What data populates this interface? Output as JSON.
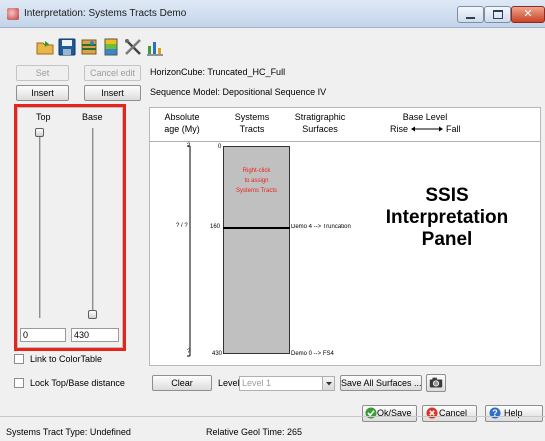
{
  "window": {
    "title": "Interpretation: Systems Tracts Demo"
  },
  "toolbar": {
    "icons": [
      "open-folder-icon",
      "save-icon",
      "layers-icon",
      "palette-icon",
      "tools-icon",
      "chart-icon"
    ]
  },
  "top_row": {
    "set_label": "Set",
    "cancel_edit_label": "Cancel edit",
    "horizon_cube": "HorizonCube: Truncated_HC_Full",
    "insert_top_label": "Insert",
    "insert_base_label": "Insert",
    "sequence_model": "Sequence Model: Depositional Sequence IV"
  },
  "left_panel": {
    "top_label": "Top",
    "base_label": "Base",
    "top_value": "0",
    "base_value": "430",
    "top_slider_fraction": 0,
    "base_slider_fraction": 1,
    "link_colortable_label": "Link to ColorTable",
    "lock_distance_label": "Lock Top/Base distance"
  },
  "headers": {
    "absolute_age": "Absolute",
    "absolute_age_unit": "age (My)",
    "systems": "Systems",
    "tracts": "Tracts",
    "stratigraphic": "Stratigraphic",
    "surfaces": "Surfaces",
    "base_level": "Base Level",
    "rise": "Rise",
    "fall": "Fall"
  },
  "panel": {
    "scale_top": "0",
    "scale_mid": "160",
    "scale_bottom": "430",
    "age_question": "? / ?",
    "age_top_mark": "?",
    "age_bottom_mark": "?",
    "right_click_1": "Right-click",
    "right_click_2": "to assign",
    "right_click_3": "Systems Tracts",
    "surface_mid": "Demo 4 --> Truncation",
    "surface_bottom": "Demo 0 --> FS4",
    "overlay_1": "SSIS",
    "overlay_2": "Interpretation",
    "overlay_3": "Panel"
  },
  "controls": {
    "clear_label": "Clear",
    "level_label": "Level",
    "level_value": "Level 1",
    "save_all_label": "Save All Surfaces ...",
    "camera_icon": "camera-icon"
  },
  "dialog_buttons": {
    "ok_save": "Ok/Save",
    "cancel": "Cancel",
    "help": "Help"
  },
  "status": {
    "tract_type": "Systems Tract Type: Undefined",
    "geol_time": "Relative Geol Time: 265"
  },
  "colors": {
    "highlight_frame": "#e8231a",
    "tract_fill": "#c0c0c0",
    "hint_text": "#e8231a",
    "ok_green": "#3a9b38",
    "cancel_red": "#d9352a",
    "help_blue": "#2e6fc4"
  }
}
